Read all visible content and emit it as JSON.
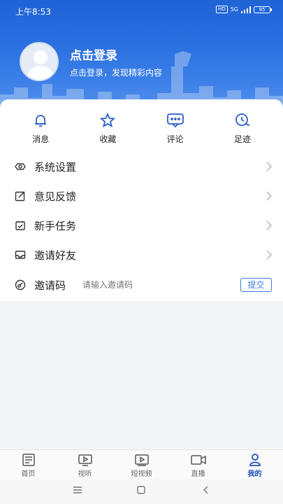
{
  "status_bar": {
    "time": "上午8:53",
    "network": "5G",
    "battery": "95"
  },
  "profile": {
    "title": "点击登录",
    "subtitle": "点击登录，发现精彩内容"
  },
  "quick_actions": [
    {
      "label": "消息",
      "icon": "bell-icon"
    },
    {
      "label": "收藏",
      "icon": "star-icon"
    },
    {
      "label": "评论",
      "icon": "comment-icon"
    },
    {
      "label": "足迹",
      "icon": "footprint-icon"
    }
  ],
  "menu": [
    {
      "label": "系统设置",
      "icon": "eye-settings-icon"
    },
    {
      "label": "意见反馈",
      "icon": "edit-icon"
    },
    {
      "label": "新手任务",
      "icon": "task-icon"
    },
    {
      "label": "邀请好友",
      "icon": "inbox-icon"
    }
  ],
  "invite": {
    "label": "邀请码",
    "placeholder": "请输入邀请码",
    "submit": "提交"
  },
  "tabbar": [
    {
      "label": "首页",
      "icon": "newspaper-icon",
      "active": false
    },
    {
      "label": "视听",
      "icon": "tv-icon",
      "active": false
    },
    {
      "label": "短视频",
      "icon": "short-video-icon",
      "active": false
    },
    {
      "label": "直播",
      "icon": "live-camera-icon",
      "active": false
    },
    {
      "label": "我的",
      "icon": "user-icon",
      "active": true
    }
  ],
  "colors": {
    "brand_blue": "#2a6fe0",
    "accent": "#3a7be0",
    "active_tab": "#1d4fb8"
  }
}
